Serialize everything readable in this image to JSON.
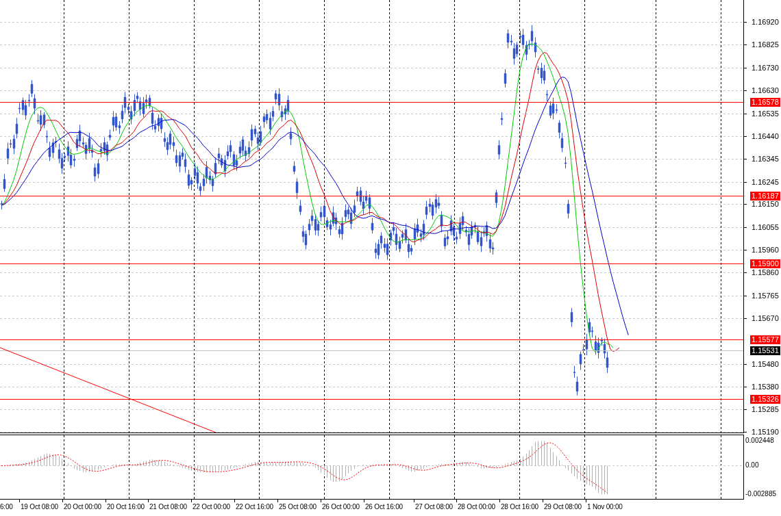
{
  "price_axis": {
    "ticks": [
      "1.16920",
      "1.16825",
      "1.16730",
      "1.16630",
      "1.16535",
      "1.16440",
      "1.16345",
      "1.16245",
      "1.16150",
      "1.16055",
      "1.15960",
      "1.15860",
      "1.15765",
      "1.15670",
      "1.15480",
      "1.15380",
      "1.15285",
      "1.15190"
    ]
  },
  "levels": [
    {
      "label": "1.16578",
      "kind": "level"
    },
    {
      "label": "1.16187",
      "kind": "level"
    },
    {
      "label": "1.15900",
      "kind": "level"
    },
    {
      "label": "1.15577",
      "kind": "level"
    },
    {
      "label": "1.15531",
      "kind": "bid"
    },
    {
      "label": "1.15326",
      "kind": "level"
    }
  ],
  "indicator_axis": {
    "ticks": [
      "0.002448",
      "0.00",
      "-0.002885"
    ]
  },
  "time_axis": {
    "ticks": [
      "6:00",
      "19 Oct 08:00",
      "20 Oct 00:00",
      "20 Oct 16:00",
      "21 Oct 08:00",
      "22 Oct 00:00",
      "22 Oct 16:00",
      "25 Oct 08:00",
      "26 Oct 00:00",
      "26 Oct 16:00",
      "27 Oct 08:00",
      "28 Oct 00:00",
      "28 Oct 16:00",
      "29 Oct 08:00",
      "1 Nov 00:00"
    ]
  }
}
